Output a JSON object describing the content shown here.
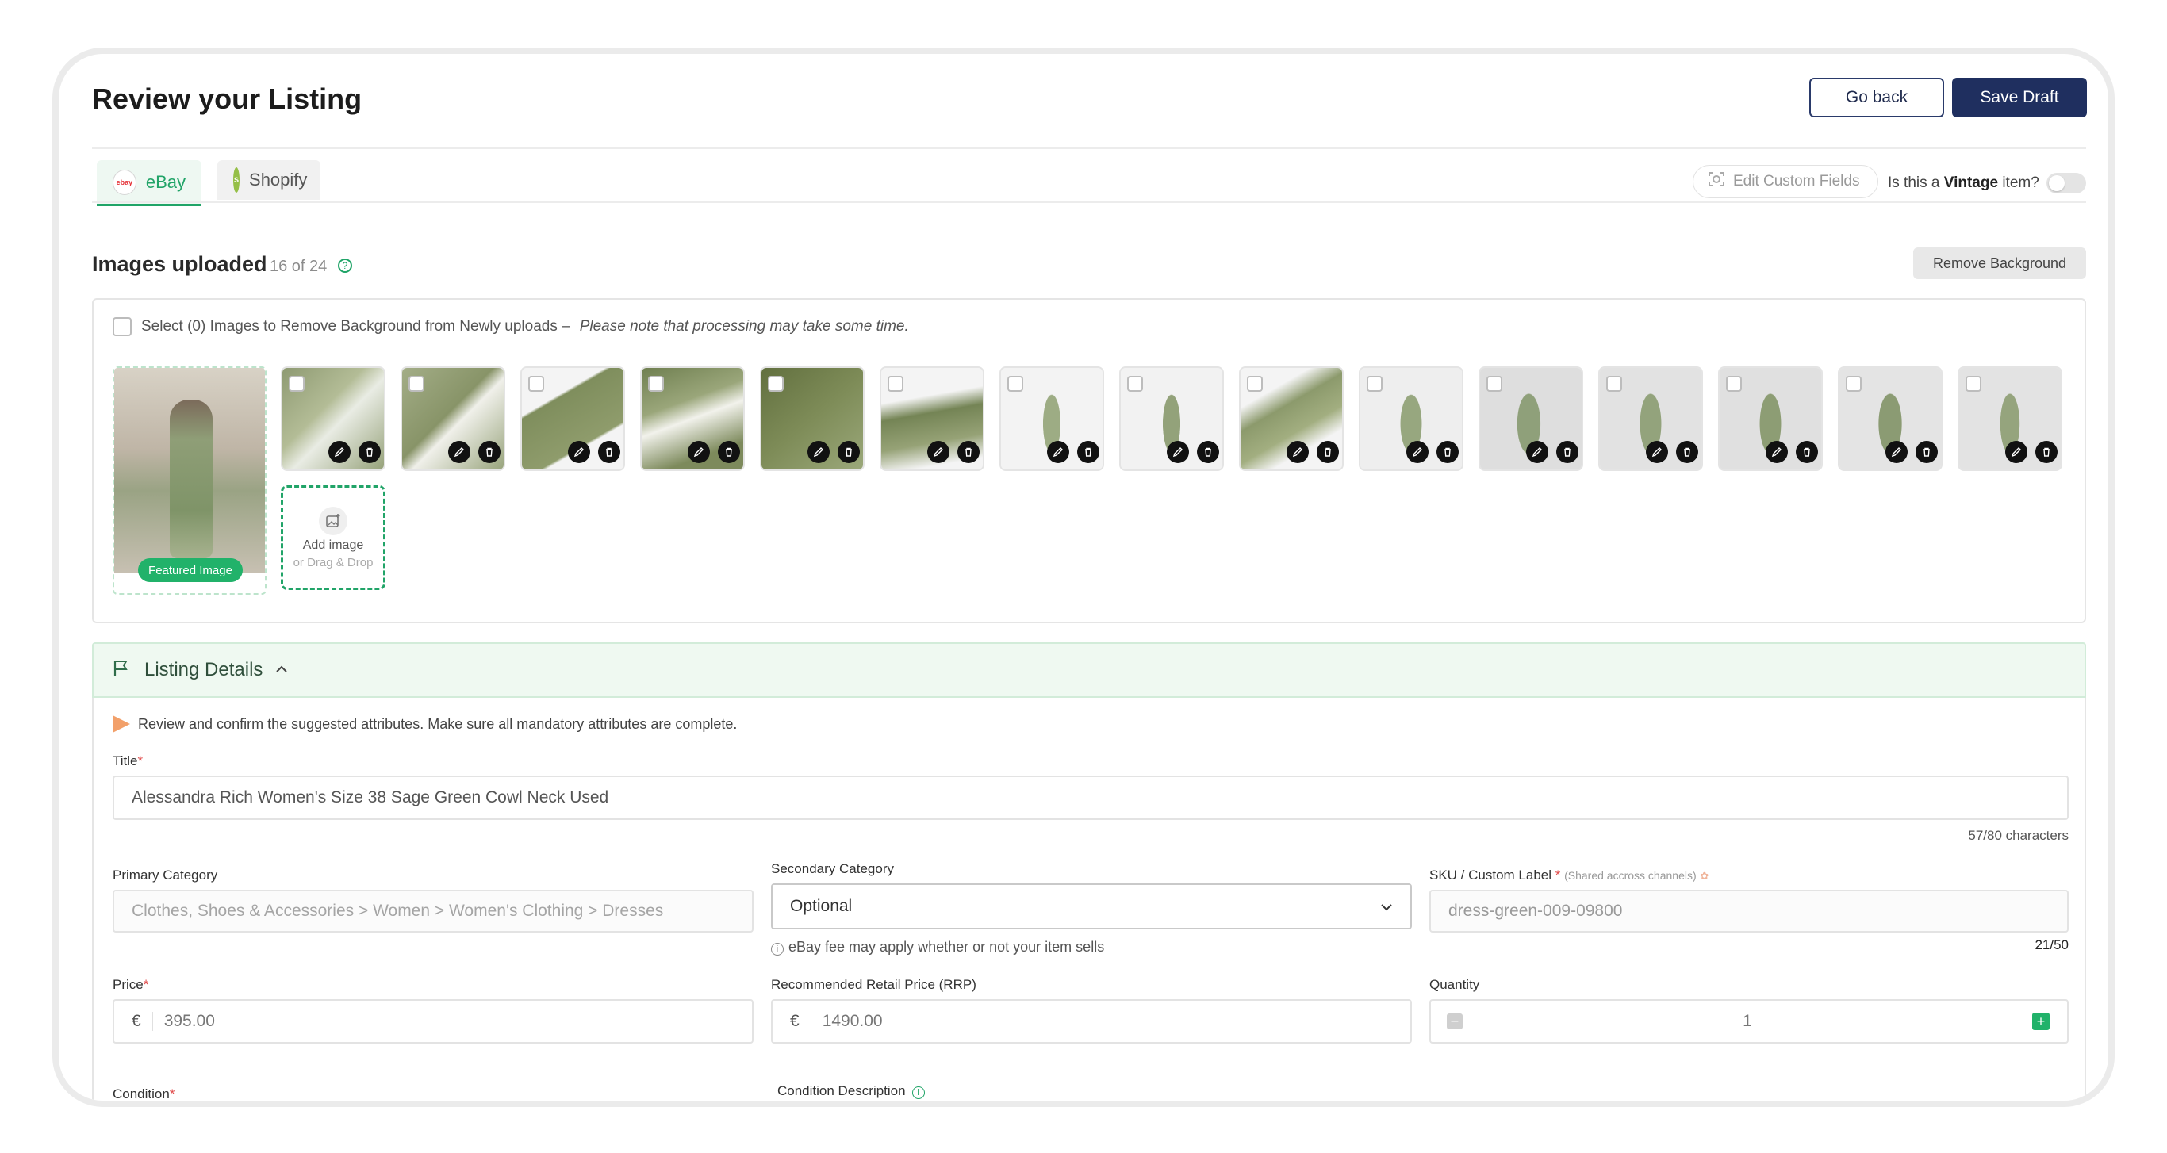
{
  "header": {
    "title": "Review your Listing",
    "go_back": "Go back",
    "save_draft": "Save Draft"
  },
  "tabs": [
    {
      "label": "eBay",
      "icon_text": "ebay"
    },
    {
      "label": "Shopify",
      "icon_text": "S"
    }
  ],
  "toolbar": {
    "edit_custom_fields": "Edit Custom Fields",
    "vintage_prefix": "Is this a",
    "vintage_bold": "Vintage",
    "vintage_suffix": "item?",
    "vintage_on": false
  },
  "images": {
    "title": "Images uploaded",
    "count": "16 of 24",
    "remove_bg": "Remove Background",
    "select_text": "Select (0) Images to Remove Background from Newly uploads –",
    "select_note": "Please note that processing may take some time.",
    "featured_label": "Featured Image",
    "add_image": "Add image",
    "add_image_sub": "or Drag & Drop"
  },
  "listing": {
    "section_title": "Listing Details",
    "hint": "Review and confirm the suggested attributes. Make sure all mandatory attributes are complete.",
    "title_label": "Title",
    "title_value": "Alessandra Rich Women's Size 38 Sage Green Cowl Neck Used",
    "title_count": "57/80 characters",
    "primary_category_label": "Primary Category",
    "primary_category_value": "Clothes, Shoes & Accessories > Women > Women's Clothing > Dresses",
    "secondary_category_label": "Secondary Category",
    "secondary_category_value": "Optional",
    "secondary_note": "eBay fee may apply whether or not your item sells",
    "sku_label": "SKU / Custom Label",
    "sku_note": "(Shared accross channels)",
    "sku_value": "dress-green-009-09800",
    "sku_count": "21/50",
    "price_label": "Price",
    "price_currency": "€",
    "price_value": "395.00",
    "rrp_label": "Recommended Retail Price (RRP)",
    "rrp_currency": "€",
    "rrp_value": "1490.00",
    "quantity_label": "Quantity",
    "quantity_value": "1",
    "condition_label": "Condition",
    "condition_desc_label": "Condition Description"
  },
  "colors": {
    "accent": "#21a468",
    "primary": "#1f2f5f"
  }
}
